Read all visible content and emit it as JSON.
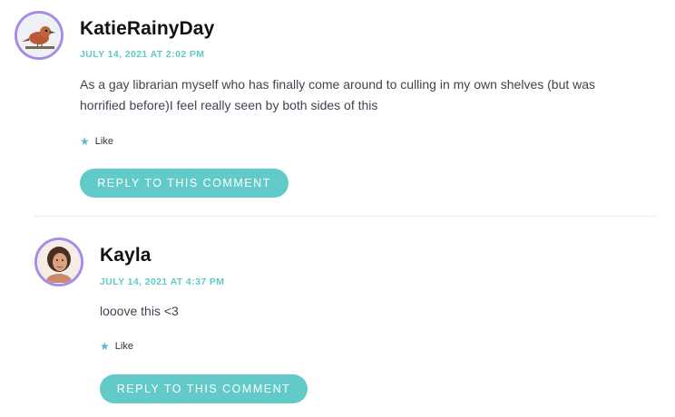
{
  "comments": [
    {
      "author": "KatieRainyDay",
      "date": "JULY 14, 2021 AT 2:02 PM",
      "text": "As a gay librarian myself who has finally come around to culling in my own shelves (but was horrified before)I feel really seen by both sides of this",
      "like_label": "Like",
      "reply_label": "REPLY TO THIS COMMENT",
      "avatar_icon": "bird-avatar"
    },
    {
      "author": "Kayla",
      "date": "JULY 14, 2021 AT 4:37 PM",
      "text": "looove this <3",
      "like_label": "Like",
      "reply_label": "REPLY TO THIS COMMENT",
      "avatar_icon": "person-avatar"
    }
  ],
  "colors": {
    "accent": "#62cbc9",
    "date": "#5fc9c6",
    "avatar_border": "#a98be6",
    "like_star": "#59b8d4"
  }
}
